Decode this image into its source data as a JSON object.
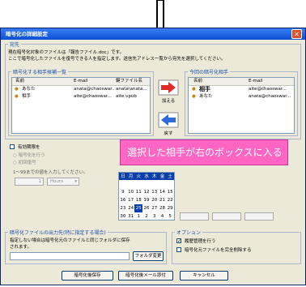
{
  "dialog": {
    "title": "暗号化の詳細設定",
    "close_glyph": "✕",
    "dest_group_title": "宛先",
    "instruction_line1": "現在暗号化対象のファイルは「報告ファイル.doc」です。",
    "instruction_line2": "ここで暗号化したファイルを復号できる人を指定します。送信先アドレス一覧から宛先を選択してください。",
    "candidates_title": "暗号化する相手候補一覧",
    "current_title": "今回の暗号化相手",
    "columns": {
      "name": "名前",
      "email": "E-mail",
      "keyfile": "鍵ファイル名"
    },
    "candidates": [
      {
        "name": "あなた",
        "email": "anata@chaoswar...",
        "keyfile": "anata\\anata..."
      },
      {
        "name": "相手",
        "email": "aite@chaoswar...",
        "keyfile": "aite.vpub"
      }
    ],
    "current": [
      {
        "name": "相手",
        "email": "aite@chaoswar..."
      },
      {
        "name": "あなた",
        "email": "anata@chaoswar..."
      }
    ],
    "add_label": "加える",
    "remove_label": "戻す",
    "expiry_check": "有効期限を",
    "radio1": "暗号化を行う",
    "radio2": "初回復号",
    "range_note": "1〜99までの値を入力してください。",
    "hours_value": "1",
    "hours_unit": "Hours",
    "calendar_header": [
      "日",
      "月",
      "火",
      "水",
      "木",
      "金",
      "土"
    ],
    "calendar_rows": [
      [
        "",
        "",
        "",
        "",
        "",
        "",
        ""
      ],
      [
        "9",
        "10",
        "11",
        "12",
        "13",
        "14",
        "15"
      ],
      [
        "16",
        "17",
        "18",
        "19",
        "20",
        "21",
        "22"
      ],
      [
        "23",
        "24",
        "25",
        "26",
        "27",
        "28",
        "29"
      ],
      [
        "30",
        "31",
        "1",
        "2",
        "3",
        "4",
        "5"
      ]
    ],
    "output_title": "暗号化ファイルの出力先(特に指定する場合)",
    "output_note": "指定しない場合は暗号化元のファイルと同じフォルダに保存されます。",
    "folder_button": "フォルダ変更",
    "options_title": "オプション",
    "option1": "履歴管理を行う",
    "option2": "暗号化元ファイルを完全削除する",
    "btn_save": "暗号化後保存",
    "btn_mail": "暗号化後メール添付",
    "btn_cancel": "キャンセル"
  },
  "callout": {
    "text": "選択した相手が右のボックスに入る"
  },
  "colors": {
    "callout": "#ff66c4",
    "title": "#0b4fd4",
    "add_arrow": "#e22b2b",
    "remove_arrow": "#2f6ad8"
  }
}
